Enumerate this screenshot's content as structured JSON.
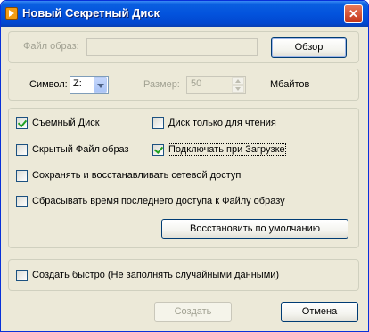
{
  "window": {
    "title": "Новый Секретный Диск"
  },
  "file": {
    "label": "Файл образ:",
    "value": "",
    "browse_label": "Обзор"
  },
  "symbol": {
    "label": "Символ:",
    "value": "Z:"
  },
  "size": {
    "label": "Размер:",
    "value": "50",
    "unit": "Мбайтов"
  },
  "options": {
    "removable": {
      "label": "Съемный Диск",
      "checked": true
    },
    "readonly": {
      "label": "Диск только для чтения",
      "checked": false
    },
    "hidden": {
      "label": "Скрытый Файл образ",
      "checked": false
    },
    "mount_on_boot": {
      "label": "Подключать при Загрузке",
      "checked": true
    },
    "network_access": {
      "label": "Сохранять и восстанавливать сетевой доступ",
      "checked": false
    },
    "reset_time": {
      "label": "Сбрасывать время последнего доступа к Файлу образу",
      "checked": false
    },
    "restore_defaults_label": "Восстановить по умолчанию"
  },
  "quick": {
    "label": "Создать быстро (Не заполнять случайными данными)",
    "checked": false
  },
  "buttons": {
    "create_label": "Создать",
    "cancel_label": "Отмена"
  }
}
